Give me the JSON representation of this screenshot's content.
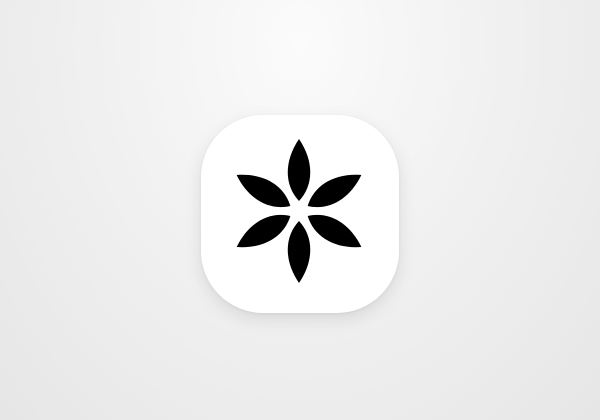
{
  "app_icon": {
    "icon": "flower-icon",
    "background_color": "#ffffff",
    "glyph_color": "#000000",
    "petal_count": 6
  }
}
